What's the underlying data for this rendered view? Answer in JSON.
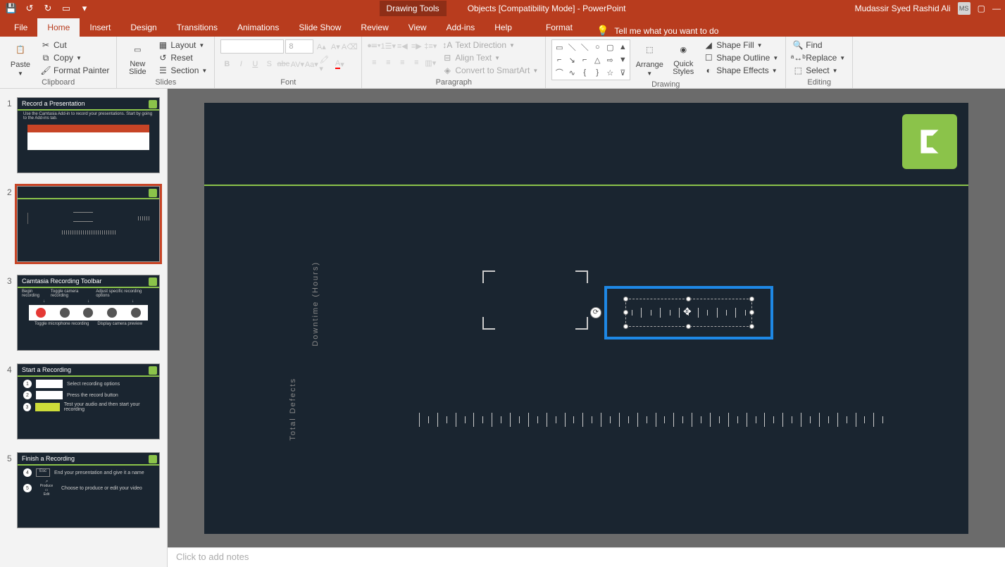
{
  "titlebar": {
    "drawing_tools": "Drawing Tools",
    "doc_title": "Objects [Compatibility Mode]  -  PowerPoint",
    "user": "Mudassir Syed Rashid Ali",
    "user_initials": "MS"
  },
  "tabs": {
    "file": "File",
    "home": "Home",
    "insert": "Insert",
    "design": "Design",
    "transitions": "Transitions",
    "animations": "Animations",
    "slideshow": "Slide Show",
    "review": "Review",
    "view": "View",
    "addins": "Add-ins",
    "help": "Help",
    "format": "Format",
    "tellme": "Tell me what you want to do"
  },
  "ribbon": {
    "clipboard": {
      "label": "Clipboard",
      "paste": "Paste",
      "cut": "Cut",
      "copy": "Copy",
      "format_painter": "Format Painter"
    },
    "slides": {
      "label": "Slides",
      "new_slide": "New\nSlide",
      "layout": "Layout",
      "reset": "Reset",
      "section": "Section"
    },
    "font": {
      "label": "Font",
      "size_value": "8"
    },
    "paragraph": {
      "label": "Paragraph",
      "text_direction": "Text Direction",
      "align_text": "Align Text",
      "convert_smartart": "Convert to SmartArt"
    },
    "drawing": {
      "label": "Drawing",
      "arrange": "Arrange",
      "quick_styles": "Quick\nStyles",
      "shape_fill": "Shape Fill",
      "shape_outline": "Shape Outline",
      "shape_effects": "Shape Effects"
    },
    "editing": {
      "label": "Editing",
      "find": "Find",
      "replace": "Replace",
      "select": "Select"
    }
  },
  "thumbs": [
    {
      "num": "1",
      "title": "Record a Presentation",
      "desc": "Use the Camtasia Add-in to record your presentations. Start by going to the Add-ins tab."
    },
    {
      "num": "2",
      "title": ""
    },
    {
      "num": "3",
      "title": "Camtasia Recording Toolbar",
      "c1": "Begin recording",
      "c2": "Toggle camera recording",
      "c3": "Adjust specific recording options",
      "f1": "Toggle microphone recording",
      "f2": "Display camera preview"
    },
    {
      "num": "4",
      "title": "Start a Recording",
      "s1": "Select recording options",
      "s2": "Press the record button",
      "s3": "Test your audio and then start your recording"
    },
    {
      "num": "5",
      "title": "Finish a Recording",
      "s1": "End your presentation and give it a name",
      "s2": "Choose to produce or edit your video",
      "produce": "Produce",
      "edit": "Edit"
    }
  ],
  "slide": {
    "label1": "Downtime (Hours)",
    "label2": "Total Defects"
  },
  "notes": {
    "placeholder": "Click to add notes"
  }
}
